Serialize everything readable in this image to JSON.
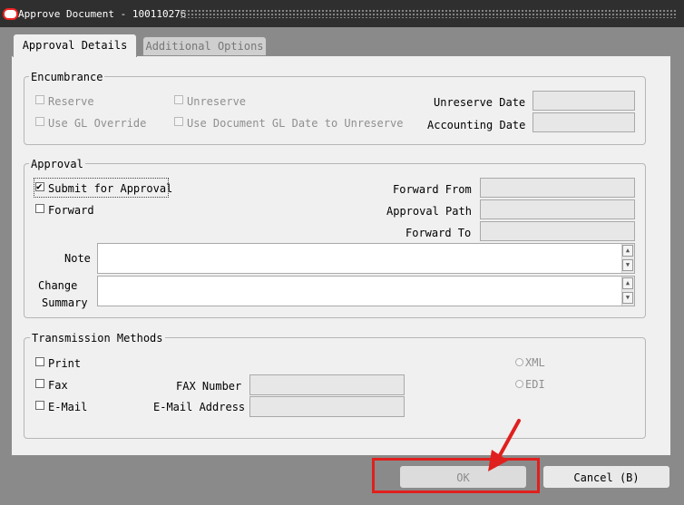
{
  "window": {
    "title": "Approve Document - 100110276"
  },
  "tabs": [
    {
      "label": "Approval Details"
    },
    {
      "label": "Additional Options"
    }
  ],
  "encumbrance": {
    "legend": "Encumbrance",
    "reserve_label": "Reserve",
    "unreserve_label": "Unreserve",
    "use_gl_override_label": "Use GL Override",
    "use_doc_gl_date_label": "Use Document GL Date to Unreserve",
    "unreserve_date_label": "Unreserve Date",
    "accounting_date_label": "Accounting Date",
    "unreserve_date_value": "",
    "accounting_date_value": ""
  },
  "approval": {
    "legend": "Approval",
    "submit_label": "Submit for Approval",
    "submit_checked": true,
    "forward_label": "Forward",
    "forward_from_label": "Forward From",
    "approval_path_label": "Approval Path",
    "forward_to_label": "Forward To",
    "note_label": "Note",
    "change_summary_label_1": "Change",
    "change_summary_label_2": "Summary",
    "note_value": "",
    "change_summary_value": ""
  },
  "transmission": {
    "legend": "Transmission Methods",
    "print_label": "Print",
    "fax_label": "Fax",
    "email_label": "E-Mail",
    "fax_number_label": "FAX Number",
    "email_address_label": "E-Mail Address",
    "xml_label": "XML",
    "edi_label": "EDI",
    "fax_number_value": "",
    "email_address_value": ""
  },
  "buttons": {
    "ok_label": "OK",
    "cancel_label": "Cancel (B)"
  },
  "colors": {
    "annotation_red": "#e0201e",
    "titlebar": "#2f2f2f",
    "panel": "#f0f0f0"
  },
  "icons": [
    "oracle-logo-icon",
    "check-icon",
    "scroll-up-icon",
    "scroll-down-icon",
    "arrow-annotation-icon"
  ]
}
